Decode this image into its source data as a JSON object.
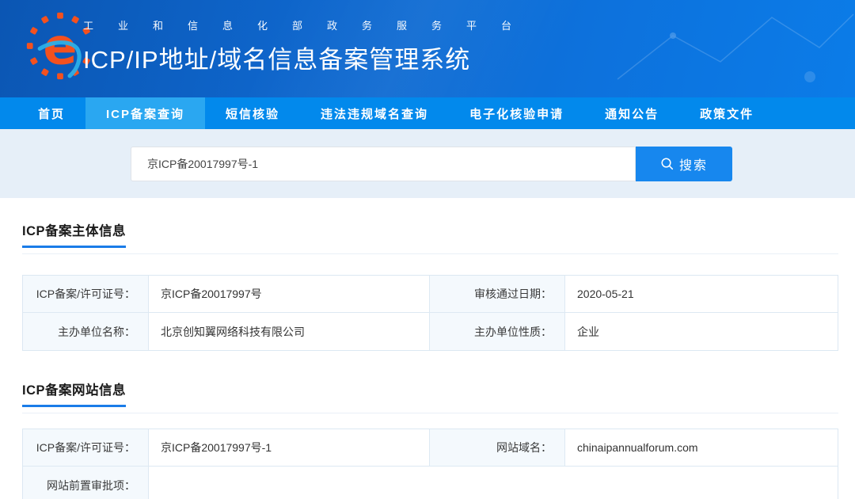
{
  "colors": {
    "header_blue_dark": "#0b56b3",
    "header_blue_bright": "#0b7ce8",
    "nav_blue": "#0289ec",
    "nav_active_blue": "#2aa7f1",
    "search_section_bg": "#e6eff8",
    "search_button_blue": "#1787ee",
    "section_underline_blue": "#1a7ce8",
    "logo_orange": "#f4511e",
    "logo_swoosh_blue": "#2bb0e8",
    "table_border": "#dde9f3",
    "label_cell_bg": "#f4f9fd"
  },
  "icons": {
    "header_logo": "gear-e-icon",
    "search_button": "magnifier-icon"
  },
  "header": {
    "platform_line": "工业和信息化部政务服务平台",
    "system_title": "ICP/IP地址/域名信息备案管理系统"
  },
  "nav": {
    "items": [
      {
        "label": "首页",
        "active": false
      },
      {
        "label": "ICP备案查询",
        "active": true
      },
      {
        "label": "短信核验",
        "active": false
      },
      {
        "label": "违法违规域名查询",
        "active": false
      },
      {
        "label": "电子化核验申请",
        "active": false
      },
      {
        "label": "通知公告",
        "active": false
      },
      {
        "label": "政策文件",
        "active": false
      }
    ]
  },
  "search": {
    "value": "京ICP备20017997号-1",
    "button_label": "搜索"
  },
  "subject_section": {
    "title": "ICP备案主体信息",
    "rows": [
      [
        {
          "label": "ICP备案/许可证号：",
          "value": "京ICP备20017997号"
        },
        {
          "label": "审核通过日期：",
          "value": "2020-05-21"
        }
      ],
      [
        {
          "label": "主办单位名称：",
          "value": "北京创知翼网络科技有限公司"
        },
        {
          "label": "主办单位性质：",
          "value": "企业"
        }
      ]
    ]
  },
  "website_section": {
    "title": "ICP备案网站信息",
    "rows": [
      [
        {
          "label": "ICP备案/许可证号：",
          "value": "京ICP备20017997号-1"
        },
        {
          "label": "网站域名：",
          "value": "chinaipannualforum.com"
        }
      ],
      [
        {
          "label": "网站前置审批项：",
          "value": ""
        }
      ]
    ]
  }
}
